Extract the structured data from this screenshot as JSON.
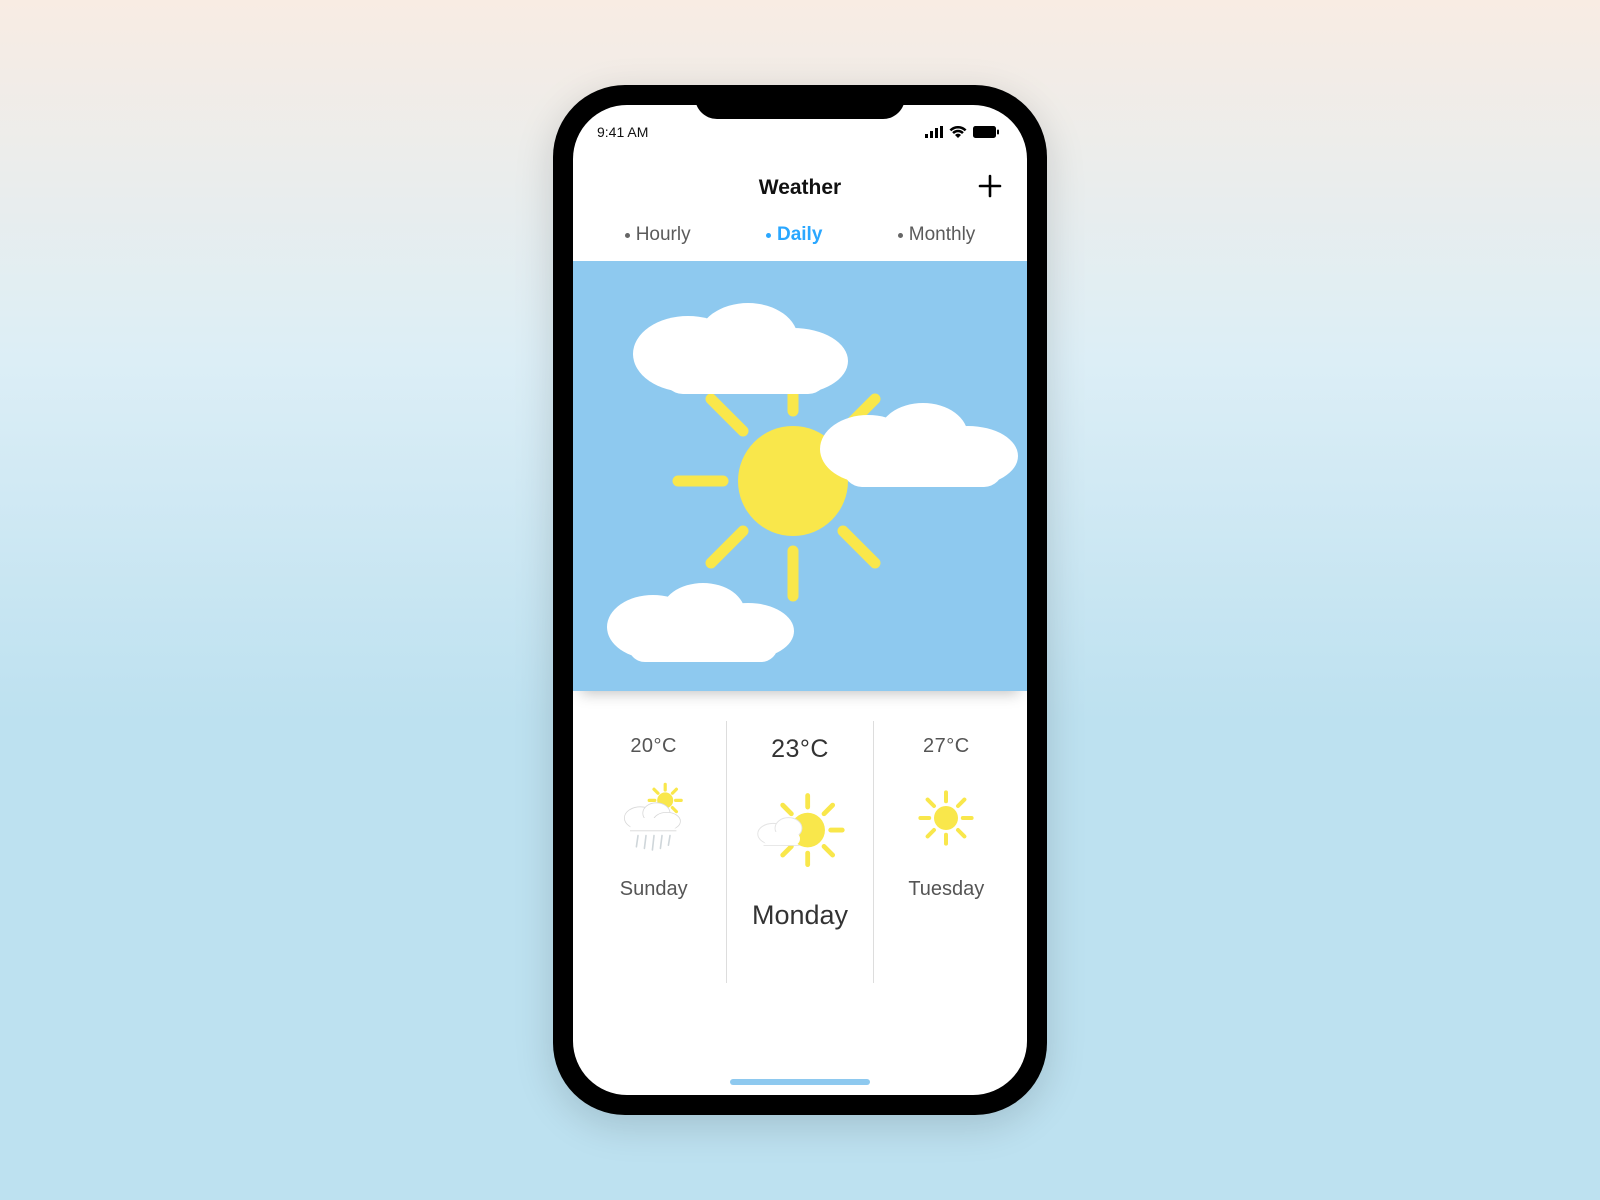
{
  "status": {
    "time": "9:41 AM"
  },
  "header": {
    "title": "Weather"
  },
  "tabs": [
    {
      "label": "Hourly",
      "active": false
    },
    {
      "label": "Daily",
      "active": true
    },
    {
      "label": "Monthly",
      "active": false
    }
  ],
  "hero": {
    "condition": "partly_cloudy"
  },
  "forecast": [
    {
      "temp": "20°C",
      "label": "Sunday",
      "icon": "cloud_sun_rain",
      "selected": false
    },
    {
      "temp": "23°C",
      "label": "Monday",
      "icon": "sun_cloud",
      "selected": true
    },
    {
      "temp": "27°C",
      "label": "Tuesday",
      "icon": "sun",
      "selected": false
    }
  ],
  "colors": {
    "sky": "#8ec9ef",
    "sun": "#f9e74b",
    "cloud": "#ffffff",
    "accent": "#2aa7ff"
  }
}
